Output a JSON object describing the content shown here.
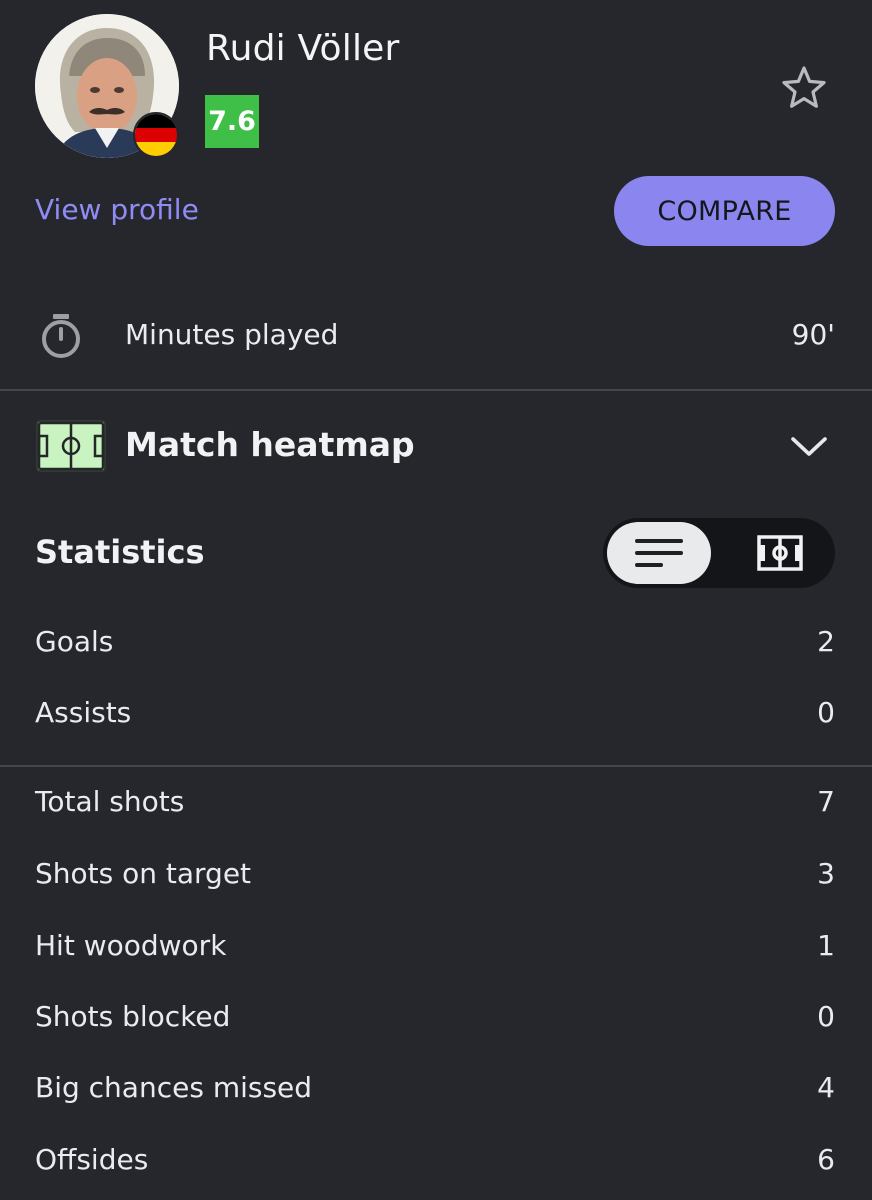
{
  "player": {
    "name": "Rudi Völler",
    "rating": "7.6",
    "rating_color": "#3fbf48",
    "nationality_flag": "germany-flag-icon",
    "flag_colors": [
      "#000000",
      "#dd0000",
      "#ffce00"
    ]
  },
  "actions": {
    "view_profile": "View profile",
    "compare": "COMPARE",
    "accent_color": "#8b86ef"
  },
  "minutes": {
    "icon": "stopwatch-icon",
    "label": "Minutes played",
    "value": "90'"
  },
  "heatmap": {
    "icon": "football-pitch-icon",
    "label": "Match heatmap",
    "toggle_icon": "chevron-down-icon"
  },
  "statistics": {
    "title": "Statistics",
    "view_toggle": {
      "active": "list-view-icon",
      "inactive": "pitch-view-icon"
    },
    "group1": [
      {
        "label": "Goals",
        "value": "2"
      },
      {
        "label": "Assists",
        "value": "0"
      }
    ],
    "group2": [
      {
        "label": "Total shots",
        "value": "7"
      },
      {
        "label": "Shots on target",
        "value": "3"
      },
      {
        "label": "Hit woodwork",
        "value": "1"
      },
      {
        "label": "Shots blocked",
        "value": "0"
      },
      {
        "label": "Big chances missed",
        "value": "4"
      },
      {
        "label": "Offsides",
        "value": "6"
      }
    ]
  }
}
